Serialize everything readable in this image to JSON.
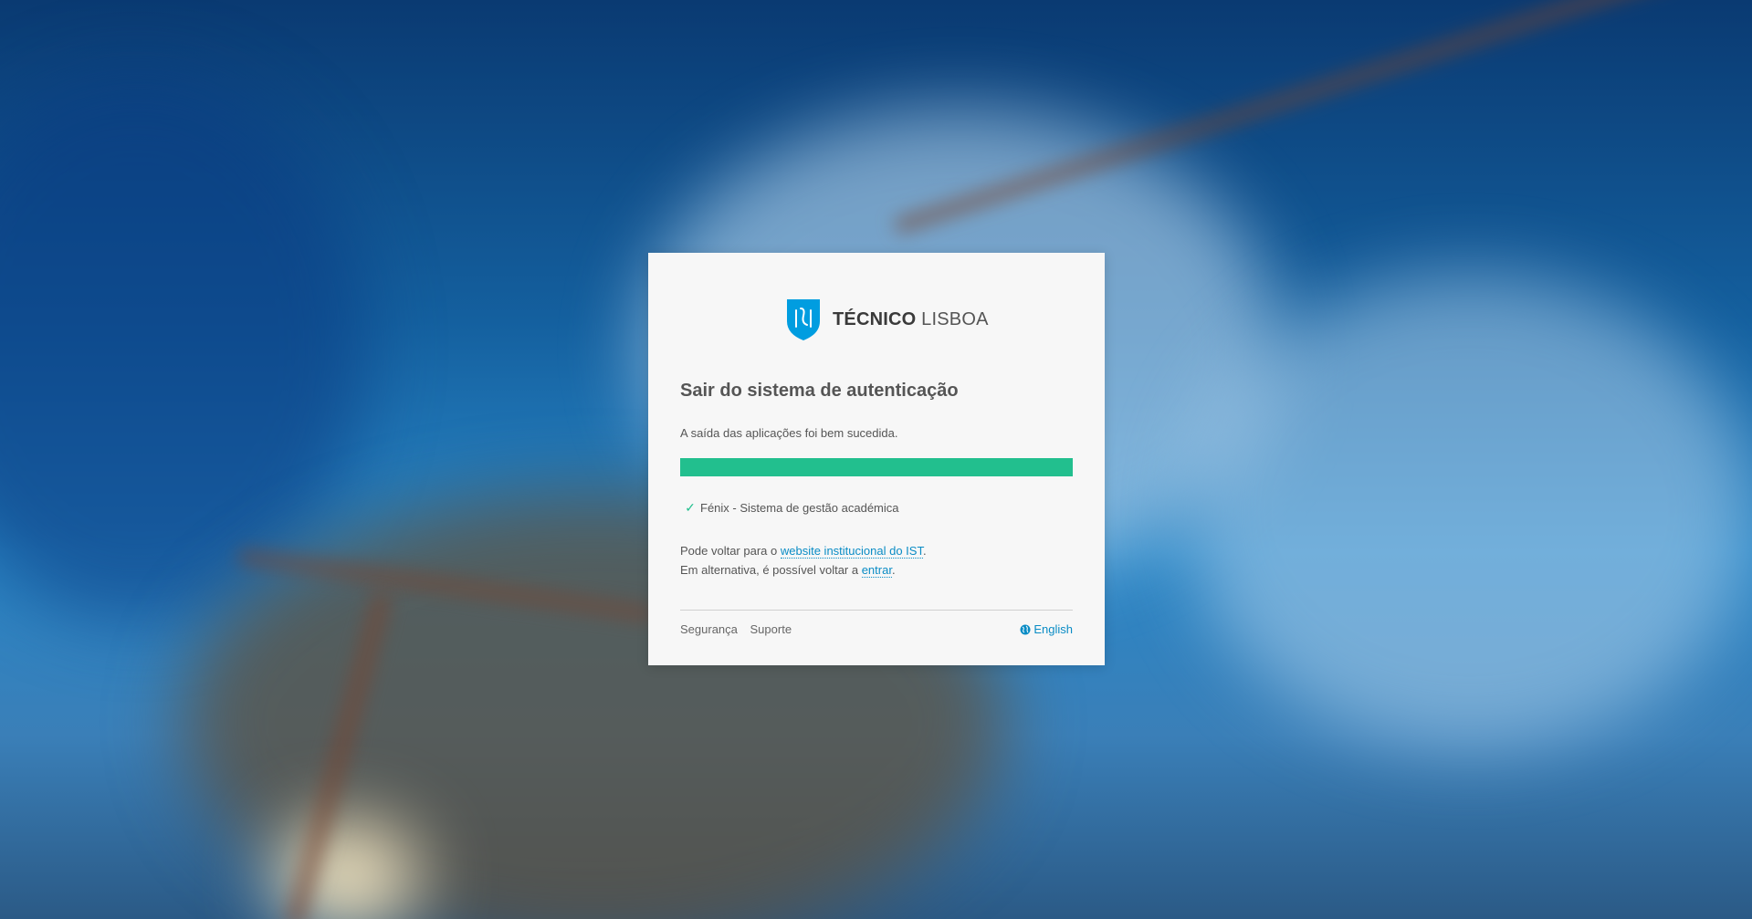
{
  "brand": {
    "name_bold": "TÉCNICO",
    "name_light": "LISBOA",
    "shield_color": "#009de0"
  },
  "page": {
    "title": "Sair do sistema de autenticação",
    "subtitle": "A saída das aplicações foi bem sucedida."
  },
  "progress": {
    "fraction": 1.0,
    "color": "#22bf8e"
  },
  "apps": [
    {
      "label": "Fénix - Sistema de gestão académica",
      "status": "check-icon"
    }
  ],
  "info": {
    "line1_prefix": "Pode voltar para o ",
    "line1_link": "website institucional do IST",
    "line1_suffix": ".",
    "line2_prefix": "Em alternativa, é possível voltar a ",
    "line2_link": "entrar",
    "line2_suffix": "."
  },
  "footer": {
    "link_security": "Segurança",
    "link_support": "Suporte",
    "language": "English",
    "language_icon": "globe-icon"
  }
}
